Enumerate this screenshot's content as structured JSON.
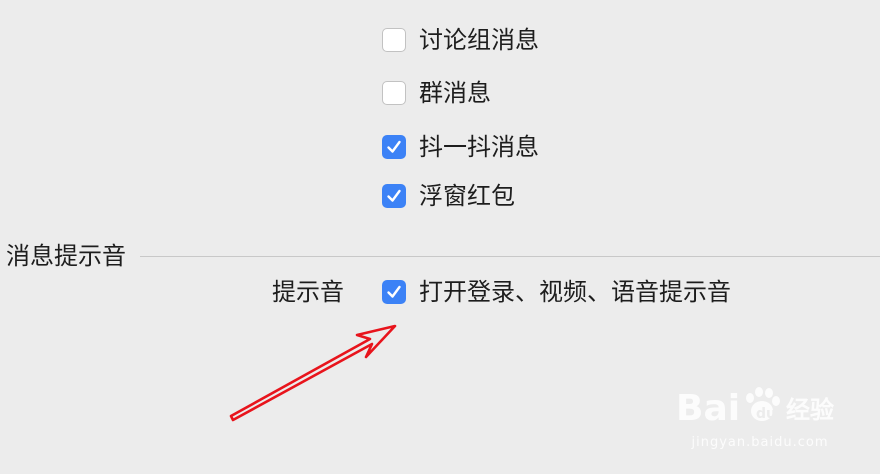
{
  "options": [
    {
      "label": "讨论组消息",
      "checked": false
    },
    {
      "label": "群消息",
      "checked": false
    },
    {
      "label": "抖一抖消息",
      "checked": true
    },
    {
      "label": "浮窗红包",
      "checked": true
    }
  ],
  "section": {
    "title": "消息提示音"
  },
  "sound": {
    "row_label": "提示音",
    "option_label": "打开登录、视频、语音提示音",
    "checked": true
  },
  "colors": {
    "background": "#ececec",
    "checkbox_checked": "#3c82f6",
    "arrow": "#e8141c"
  },
  "watermark": {
    "brand": "Baidu经验",
    "url": "jingyan.baidu.com"
  },
  "icons": [
    "checkmark-icon",
    "red-arrow-annotation",
    "baidu-paw-icon"
  ]
}
